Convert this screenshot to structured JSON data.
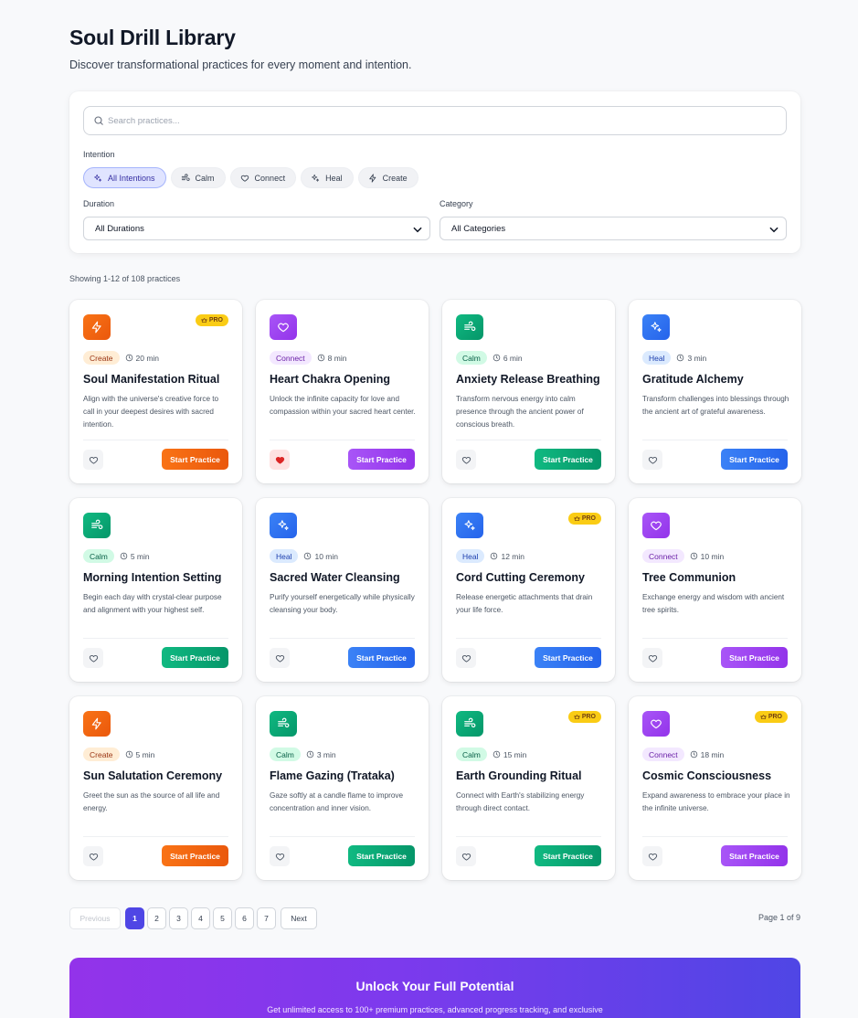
{
  "header": {
    "title": "Soul Drill Library",
    "subtitle": "Discover transformational practices for every moment and intention."
  },
  "search": {
    "placeholder": "Search practices..."
  },
  "filters": {
    "intention_label": "Intention",
    "intentions": [
      {
        "label": "All Intentions",
        "icon": "sparkles-icon",
        "active": true
      },
      {
        "label": "Calm",
        "icon": "wind-icon",
        "active": false
      },
      {
        "label": "Connect",
        "icon": "heart-icon",
        "active": false
      },
      {
        "label": "Heal",
        "icon": "sparkles-icon",
        "active": false
      },
      {
        "label": "Create",
        "icon": "zap-icon",
        "active": false
      }
    ],
    "duration_label": "Duration",
    "duration_value": "All Durations",
    "category_label": "Category",
    "category_value": "All Categories"
  },
  "results": {
    "showing": "Showing 1-12 of 108 practices"
  },
  "pro_label": "PRO",
  "start_label": "Start Practice",
  "colors": {
    "Create": {
      "main": "#f97316",
      "grad": "#ea580c",
      "tagbg": "#ffedd5",
      "tagfg": "#9a3412",
      "icon": "zap-icon"
    },
    "Connect": {
      "main": "#a855f7",
      "grad": "#9333ea",
      "tagbg": "#f3e8ff",
      "tagfg": "#6b21a8",
      "icon": "heart-icon"
    },
    "Calm": {
      "main": "#10b981",
      "grad": "#059669",
      "tagbg": "#d1fae5",
      "tagfg": "#065f46",
      "icon": "wind-icon"
    },
    "Heal": {
      "main": "#3b82f6",
      "grad": "#2563eb",
      "tagbg": "#dbeafe",
      "tagfg": "#1e40af",
      "icon": "sparkles-icon"
    }
  },
  "practices": [
    {
      "category": "Create",
      "duration": "20 min",
      "title": "Soul Manifestation Ritual",
      "description": "Align with the universe's creative force to call in your deepest desires with sacred intention.",
      "pro": true,
      "favorite": false
    },
    {
      "category": "Connect",
      "duration": "8 min",
      "title": "Heart Chakra Opening",
      "description": "Unlock the infinite capacity for love and compassion within your sacred heart center.",
      "pro": false,
      "favorite": true
    },
    {
      "category": "Calm",
      "duration": "6 min",
      "title": "Anxiety Release Breathing",
      "description": "Transform nervous energy into calm presence through the ancient power of conscious breath.",
      "pro": false,
      "favorite": false
    },
    {
      "category": "Heal",
      "duration": "3 min",
      "title": "Gratitude Alchemy",
      "description": "Transform challenges into blessings through the ancient art of grateful awareness.",
      "pro": false,
      "favorite": false
    },
    {
      "category": "Calm",
      "duration": "5 min",
      "title": "Morning Intention Setting",
      "description": "Begin each day with crystal-clear purpose and alignment with your highest self.",
      "pro": false,
      "favorite": false
    },
    {
      "category": "Heal",
      "duration": "10 min",
      "title": "Sacred Water Cleansing",
      "description": "Purify yourself energetically while physically cleansing your body.",
      "pro": false,
      "favorite": false
    },
    {
      "category": "Heal",
      "duration": "12 min",
      "title": "Cord Cutting Ceremony",
      "description": "Release energetic attachments that drain your life force.",
      "pro": true,
      "favorite": false
    },
    {
      "category": "Connect",
      "duration": "10 min",
      "title": "Tree Communion",
      "description": "Exchange energy and wisdom with ancient tree spirits.",
      "pro": false,
      "favorite": false
    },
    {
      "category": "Create",
      "duration": "5 min",
      "title": "Sun Salutation Ceremony",
      "description": "Greet the sun as the source of all life and energy.",
      "pro": false,
      "favorite": false
    },
    {
      "category": "Calm",
      "duration": "3 min",
      "title": "Flame Gazing (Trataka)",
      "description": "Gaze softly at a candle flame to improve concentration and inner vision.",
      "pro": false,
      "favorite": false
    },
    {
      "category": "Calm",
      "duration": "15 min",
      "title": "Earth Grounding Ritual",
      "description": "Connect with Earth's stabilizing energy through direct contact.",
      "pro": true,
      "favorite": false
    },
    {
      "category": "Connect",
      "duration": "18 min",
      "title": "Cosmic Consciousness",
      "description": "Expand awareness to embrace your place in the infinite universe.",
      "pro": true,
      "favorite": false
    }
  ],
  "pagination": {
    "previous": "Previous",
    "next": "Next",
    "pages": [
      "1",
      "2",
      "3",
      "4",
      "5",
      "6",
      "7"
    ],
    "current": "1",
    "page_of": "Page 1 of 9"
  },
  "banner": {
    "title": "Unlock Your Full Potential",
    "subtitle": "Get unlimited access to 100+ premium practices, advanced progress tracking, and exclusive"
  }
}
